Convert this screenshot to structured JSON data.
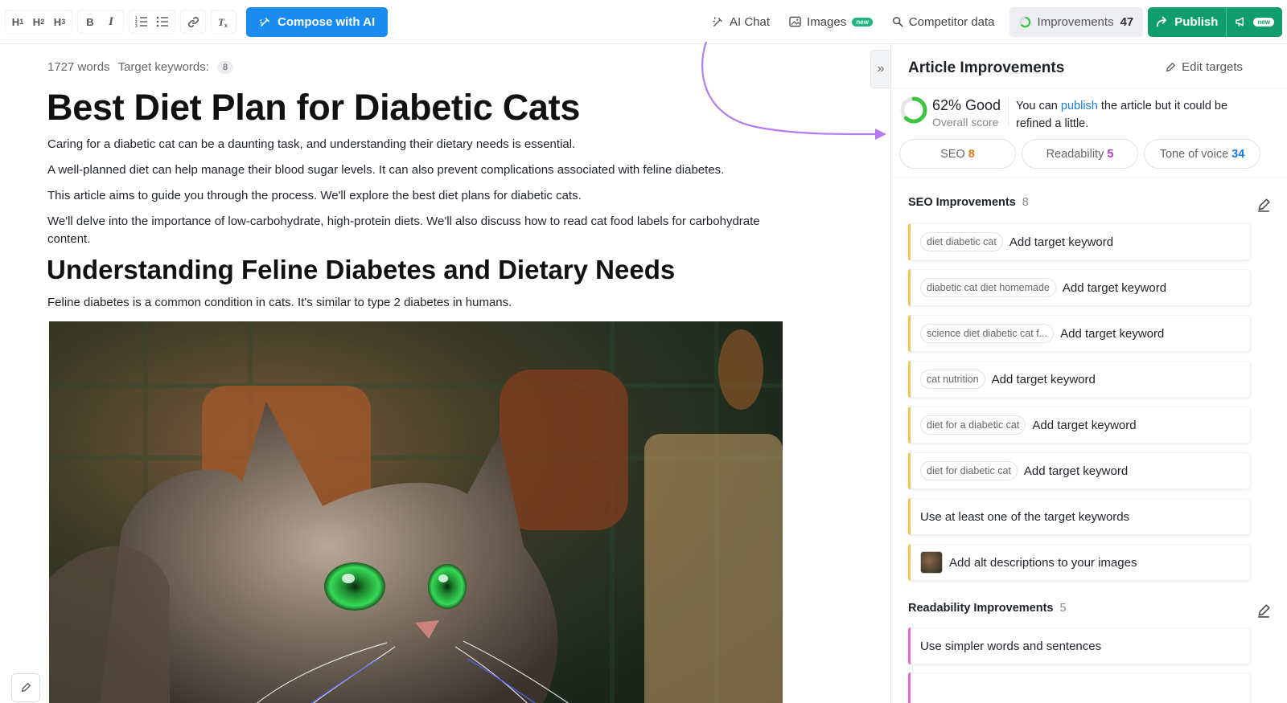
{
  "toolbar": {
    "h1": "H",
    "h1_sub": "1",
    "h2": "H",
    "h2_sub": "2",
    "h3": "H",
    "h3_sub": "3",
    "bold": "B",
    "italic": "I",
    "compose_label": "Compose with AI",
    "ai_chat": "AI Chat",
    "images": "Images",
    "images_badge": "new",
    "competitor": "Competitor data",
    "improvements_label": "Improvements",
    "improvements_count": "47",
    "publish_label": "Publish",
    "publish_badge": "new"
  },
  "editor": {
    "word_count": "1727 words",
    "target_keywords_label": "Target keywords:",
    "target_keywords_count": "8",
    "title": "Best Diet Plan for Diabetic Cats",
    "paragraphs": [
      "Caring for a diabetic cat can be a daunting task, and understanding their dietary needs is essential.",
      "A well-planned diet can help manage their blood sugar levels. It can also prevent complications associated with feline diabetes.",
      "This article aims to guide you through the process. We'll explore the best diet plans for diabetic cats.",
      "We'll delve into the importance of low-carbohydrate, high-protein diets. We'll also discuss how to read cat food labels for carbohydrate content."
    ],
    "heading2": "Understanding Feline Diabetes and Dietary Needs",
    "paragraph2": "Feline diabetes is a common condition in cats. It's similar to type 2 diabetes in humans."
  },
  "panel": {
    "title": "Article Improvements",
    "edit_targets": "Edit targets",
    "score_value": "62% Good",
    "score_fraction": 0.62,
    "score_label": "Overall score",
    "msg_before": "You can ",
    "msg_link": "publish",
    "msg_after": " the article but it could be refined a little.",
    "tabs": [
      {
        "label": "SEO",
        "count": "8",
        "color": "#e07b1a"
      },
      {
        "label": "Readability",
        "count": "5",
        "color": "#b23fc9"
      },
      {
        "label": "Tone of voice",
        "count": "34",
        "color": "#1a7ee0"
      }
    ],
    "seo_title": "SEO Improvements",
    "seo_count": "8",
    "seo_items": [
      {
        "chip": "diet diabetic cat",
        "text": "Add target keyword"
      },
      {
        "chip": "diabetic cat diet homemade",
        "text": "Add target keyword"
      },
      {
        "chip": "science diet diabetic cat f...",
        "text": "Add target keyword"
      },
      {
        "chip": "cat nutrition",
        "text": "Add target keyword"
      },
      {
        "chip": "diet for a diabetic cat",
        "text": "Add target keyword"
      },
      {
        "chip": "diet for diabetic cat",
        "text": "Add target keyword"
      },
      {
        "chip": "",
        "text": "Use at least one of the target keywords"
      },
      {
        "chip": "",
        "text": "Add alt descriptions to your images"
      }
    ],
    "readability_title": "Readability Improvements",
    "readability_count": "5",
    "readability_items": [
      {
        "text": "Use simpler words and sentences"
      }
    ]
  },
  "colors": {
    "compose": "#1a8cf0",
    "publish": "#0f9d6e",
    "seo_accent": "#f5c350",
    "readability_accent": "#e46bd0",
    "arrow": "#b57cf0",
    "score_ring": "#3ec43e"
  }
}
